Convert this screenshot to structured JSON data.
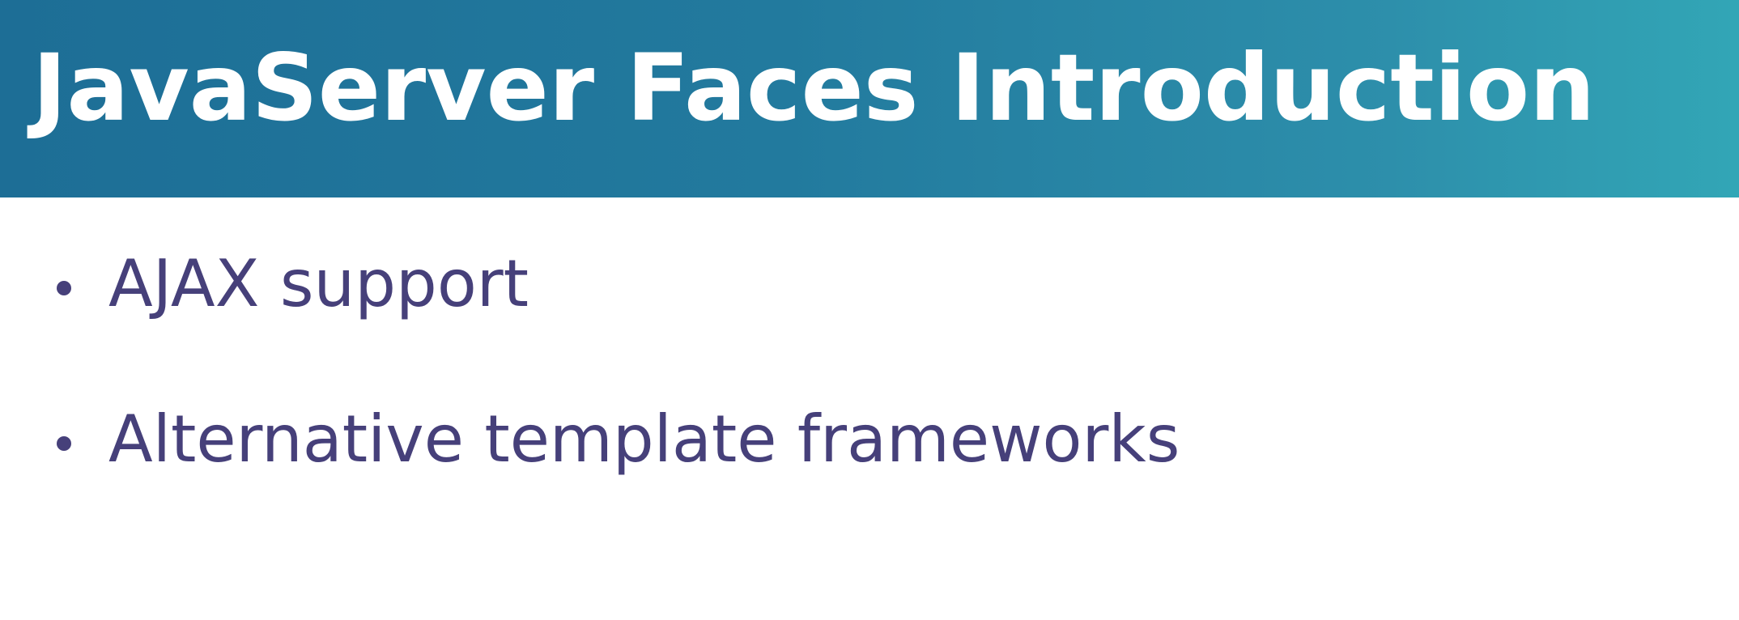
{
  "slide": {
    "title": "JavaServer Faces Introduction",
    "bullets": [
      {
        "text": "AJAX support"
      },
      {
        "text": "Alternative template frameworks"
      }
    ]
  },
  "colors": {
    "header_start": "#1d6e96",
    "header_end": "#32a6b6",
    "title_text": "#ffffff",
    "bullet_text": "#46407a",
    "background": "#ffffff"
  }
}
